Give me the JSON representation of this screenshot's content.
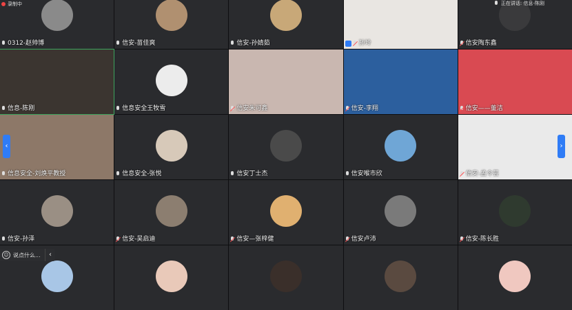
{
  "recording": {
    "label": "录制中"
  },
  "speaking": {
    "label": "正在讲话: 信息-陈刚"
  },
  "chat": {
    "placeholder": "说点什么...",
    "collapse_icon": "chevron-left-icon"
  },
  "tiles": [
    {
      "name": "0312-赵帅博",
      "muted": false,
      "kind": "avatar",
      "bg": "#2a2b2e",
      "avatar": "#8a8a8a"
    },
    {
      "name": "信安-苗佳爽",
      "muted": false,
      "kind": "avatar",
      "bg": "#2a2b2e",
      "avatar": "#b09070"
    },
    {
      "name": "信安-孙婧茹",
      "muted": false,
      "kind": "avatar",
      "bg": "#2a2b2e",
      "avatar": "#c8a878"
    },
    {
      "name": "孙玲",
      "muted": true,
      "kind": "video",
      "bg": "#e9e6e2",
      "badge": true
    },
    {
      "name": "信安陶东鑫",
      "muted": true,
      "kind": "avatar",
      "bg": "#2a2b2e",
      "avatar": "#3a3a3c"
    },
    {
      "name": "信息-陈刚",
      "muted": false,
      "kind": "video",
      "bg": "#3b3530",
      "speaking": true
    },
    {
      "name": "信息安全王牧雪",
      "muted": false,
      "kind": "avatar",
      "bg": "#2a2b2e",
      "avatar": "#ececec"
    },
    {
      "name": "信安朱可鑫",
      "muted": true,
      "kind": "video",
      "bg": "#c9b7b0"
    },
    {
      "name": "信安-李翔",
      "muted": true,
      "kind": "video",
      "bg": "#2c5f9e"
    },
    {
      "name": "信安——董洁",
      "muted": true,
      "kind": "video",
      "bg": "#d94a52"
    },
    {
      "name": "信息安全-刘焕平教授",
      "muted": false,
      "kind": "video",
      "bg": "#8d7868"
    },
    {
      "name": "信息安全-张悦",
      "muted": false,
      "kind": "avatar",
      "bg": "#2a2b2e",
      "avatar": "#d7c9b9"
    },
    {
      "name": "信安丁士杰",
      "muted": false,
      "kind": "avatar",
      "bg": "#2a2b2e",
      "avatar": "#4a4a4a"
    },
    {
      "name": "信安喉市欣",
      "muted": false,
      "kind": "avatar",
      "bg": "#2a2b2e",
      "avatar": "#6fa6d6"
    },
    {
      "name": "信安-孟令芸",
      "muted": true,
      "kind": "video",
      "bg": "#eaeaea"
    },
    {
      "name": "信安-孙泽",
      "muted": false,
      "kind": "avatar",
      "bg": "#2a2b2e",
      "avatar": "#9a8f84"
    },
    {
      "name": "信安-吴启迪",
      "muted": true,
      "kind": "avatar",
      "bg": "#2a2b2e",
      "avatar": "#8c7e70"
    },
    {
      "name": "信安—张梓健",
      "muted": true,
      "kind": "avatar",
      "bg": "#2a2b2e",
      "avatar": "#e0b070"
    },
    {
      "name": "信安卢沛",
      "muted": true,
      "kind": "avatar",
      "bg": "#2a2b2e",
      "avatar": "#7a7a7a"
    },
    {
      "name": "信安-陈长胜",
      "muted": true,
      "kind": "avatar",
      "bg": "#2a2b2e",
      "avatar": "#2f3a2f"
    },
    {
      "name": "",
      "muted": false,
      "kind": "avatar",
      "bg": "#2a2b2e",
      "avatar": "#a8c6e6"
    },
    {
      "name": "",
      "muted": false,
      "kind": "avatar",
      "bg": "#2a2b2e",
      "avatar": "#e9c9b9"
    },
    {
      "name": "",
      "muted": false,
      "kind": "avatar",
      "bg": "#2a2b2e",
      "avatar": "#3a2f2a"
    },
    {
      "name": "",
      "muted": false,
      "kind": "avatar",
      "bg": "#2a2b2e",
      "avatar": "#5a4a40"
    },
    {
      "name": "",
      "muted": false,
      "kind": "avatar",
      "bg": "#2a2b2e",
      "avatar": "#f0c8c0"
    }
  ]
}
